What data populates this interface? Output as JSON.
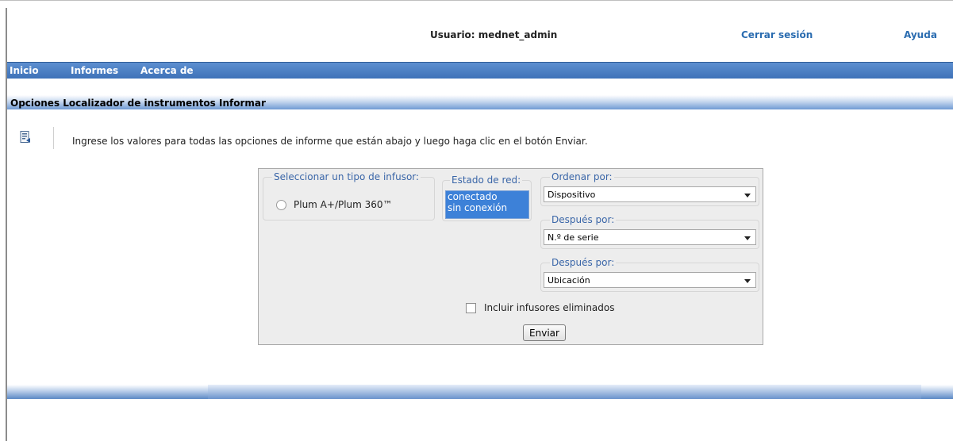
{
  "header": {
    "user_label": "Usuario: mednet_admin",
    "logout_label": "Cerrar sesión",
    "help_label": "Ayuda"
  },
  "nav": {
    "items": [
      "Inicio",
      "Informes",
      "Acerca de"
    ]
  },
  "section": {
    "title": "Opciones Localizador de instrumentos Informar"
  },
  "instructions": {
    "icon": "report-options-icon",
    "text": "Ingrese los valores para todas las opciones de informe que están abajo y luego haga clic en el botón Enviar."
  },
  "form": {
    "infusor_group": {
      "legend": "Seleccionar un tipo de infusor:",
      "option": "Plum A+/Plum 360™"
    },
    "network_group": {
      "legend": "Estado de red:",
      "options": [
        "conectado",
        "sin conexión"
      ]
    },
    "sort": {
      "order_legend": "Ordenar por:",
      "order_value": "Dispositivo",
      "then1_legend": "Después por:",
      "then1_value": "N.º de serie",
      "then2_legend": "Después por:",
      "then2_value": "Ubicación"
    },
    "include_deleted_label": "Incluir infusores eliminados",
    "submit_label": "Enviar"
  },
  "colors": {
    "nav_bar": "#4a7fc2",
    "link": "#2a6cb0",
    "legend_text": "#3a66a8",
    "selection": "#3d81d8"
  }
}
